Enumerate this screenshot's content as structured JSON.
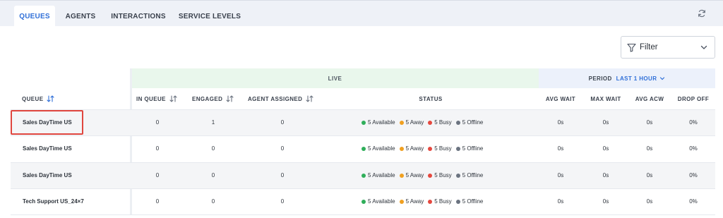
{
  "tabs": [
    {
      "label": "QUEUES",
      "active": true
    },
    {
      "label": "AGENTS",
      "active": false
    },
    {
      "label": "INTERACTIONS",
      "active": false
    },
    {
      "label": "SERVICE LEVELS",
      "active": false
    }
  ],
  "filter": {
    "label": "Filter"
  },
  "bands": {
    "live": "LIVE",
    "period_label": "PERIOD",
    "period_value": "LAST 1 HOUR"
  },
  "columns": {
    "queue": "QUEUE",
    "in_queue": "IN QUEUE",
    "engaged": "ENGAGED",
    "agent_assigned": "AGENT ASSIGNED",
    "status": "STATUS",
    "avg_wait": "AVG WAIT",
    "max_wait": "MAX WAIT",
    "avg_acw": "AVG ACW",
    "drop_off": "DROP OFF"
  },
  "status_colors": {
    "available": "#2fae5a",
    "away": "#f0a020",
    "busy": "#e5483f",
    "offline": "#6b7380"
  },
  "rows": [
    {
      "queue": "Sales DayTime US",
      "in_queue": "0",
      "engaged": "1",
      "agent_assigned": "0",
      "available": "5 Available",
      "away": "5 Away",
      "busy": "5 Busy",
      "offline": "5 Offline",
      "avg_wait": "0s",
      "max_wait": "0s",
      "avg_acw": "0s",
      "drop_off": "0%"
    },
    {
      "queue": "Sales DayTime US",
      "in_queue": "0",
      "engaged": "0",
      "agent_assigned": "0",
      "available": "5 Available",
      "away": "5 Away",
      "busy": "5 Busy",
      "offline": "5 Offline",
      "avg_wait": "0s",
      "max_wait": "0s",
      "avg_acw": "0s",
      "drop_off": "0%"
    },
    {
      "queue": "Sales DayTime US",
      "in_queue": "0",
      "engaged": "0",
      "agent_assigned": "0",
      "available": "5 Available",
      "away": "5 Away",
      "busy": "5 Busy",
      "offline": "5 Offline",
      "avg_wait": "0s",
      "max_wait": "0s",
      "avg_acw": "0s",
      "drop_off": "0%"
    },
    {
      "queue": "Tech Support US_24×7",
      "in_queue": "0",
      "engaged": "0",
      "agent_assigned": "0",
      "available": "5 Available",
      "away": "5 Away",
      "busy": "5 Busy",
      "offline": "5 Offline",
      "avg_wait": "0s",
      "max_wait": "0s",
      "avg_acw": "0s",
      "drop_off": "0%"
    }
  ]
}
